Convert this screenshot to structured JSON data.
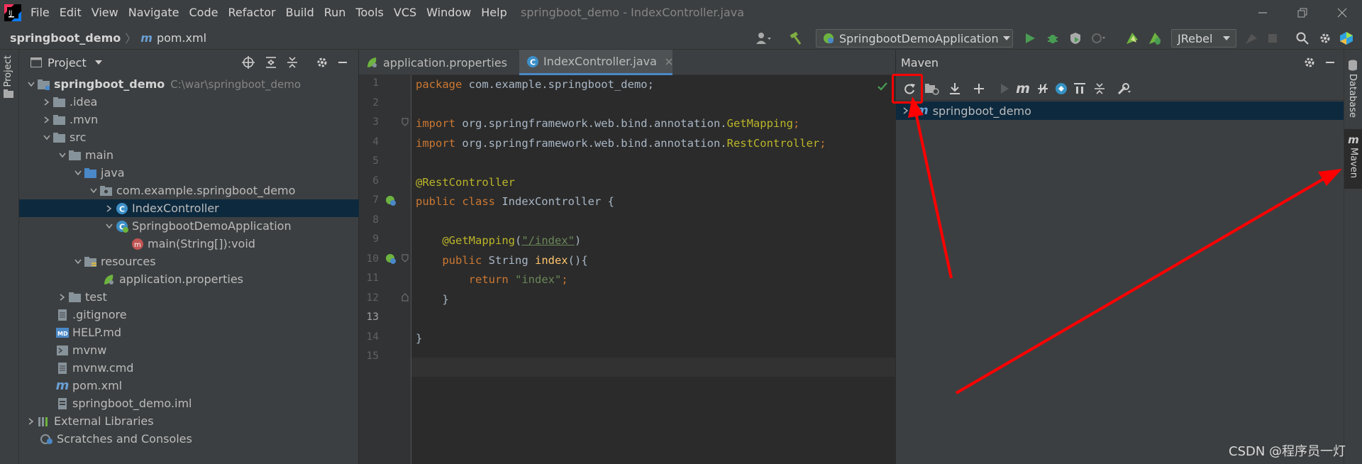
{
  "titlebar": {
    "menu": [
      "File",
      "Edit",
      "View",
      "Navigate",
      "Code",
      "Refactor",
      "Build",
      "Run",
      "Tools",
      "VCS",
      "Window",
      "Help"
    ],
    "title": "springboot_demo - IndexController.java"
  },
  "navbar": {
    "project": "springboot_demo",
    "file": "pom.xml",
    "run_config": "SpringbootDemoApplication",
    "jrebel": "JRebel"
  },
  "left_strip": {
    "project_tab": "Project"
  },
  "right_strip": {
    "database_tab": "Database",
    "maven_tab": "Maven"
  },
  "project_panel": {
    "title": "Project",
    "tree": [
      {
        "label": "springboot_demo",
        "extra": "C:\\war\\springboot_demo",
        "icon": "module-folder-icon"
      },
      {
        "label": ".idea",
        "icon": "folder-icon"
      },
      {
        "label": ".mvn",
        "icon": "folder-icon"
      },
      {
        "label": "src",
        "icon": "folder-icon"
      },
      {
        "label": "main",
        "icon": "folder-icon"
      },
      {
        "label": "java",
        "icon": "source-folder-icon"
      },
      {
        "label": "com.example.springboot_demo",
        "icon": "package-icon"
      },
      {
        "label": "IndexController",
        "icon": "class-icon"
      },
      {
        "label": "SpringbootDemoApplication",
        "icon": "spring-class-icon"
      },
      {
        "label": "main(String[]):void",
        "icon": "method-icon"
      },
      {
        "label": "resources",
        "icon": "resources-folder-icon"
      },
      {
        "label": "application.properties",
        "icon": "properties-file-icon"
      },
      {
        "label": "test",
        "icon": "folder-icon"
      },
      {
        "label": ".gitignore",
        "icon": "text-file-icon"
      },
      {
        "label": "HELP.md",
        "icon": "markdown-file-icon"
      },
      {
        "label": "mvnw",
        "icon": "script-file-icon"
      },
      {
        "label": "mvnw.cmd",
        "icon": "text-file-icon"
      },
      {
        "label": "pom.xml",
        "icon": "maven-icon"
      },
      {
        "label": "springboot_demo.iml",
        "icon": "iml-file-icon"
      },
      {
        "label": "External Libraries",
        "icon": "libraries-icon"
      },
      {
        "label": "Scratches and Consoles",
        "icon": "scratches-icon"
      }
    ]
  },
  "editor": {
    "tabs": [
      "application.properties",
      "IndexController.java"
    ],
    "active_tab": "IndexController.java",
    "line_numbers": [
      "1",
      "2",
      "3",
      "4",
      "5",
      "6",
      "7",
      "8",
      "9",
      "10",
      "11",
      "12",
      "13",
      "14",
      "15"
    ],
    "code": {
      "l1_kw": "package",
      "l1_rest": " com.example.springboot_demo;",
      "l3_kw": "import",
      "l3_pkg": " org.springframework.web.bind.annotation.",
      "l3_cls": "GetMapping",
      "l3_end": ";",
      "l4_kw": "import",
      "l4_pkg": " org.springframework.web.bind.annotation.",
      "l4_cls": "RestController",
      "l4_end": ";",
      "l6_an": "@RestController",
      "l7_kw": "public class",
      "l7_rest": " IndexController {",
      "l9_an": "    @GetMapping",
      "l9_p1": "(",
      "l9_str": "\"/index\"",
      "l9_p2": ")",
      "l10_kw": "    public",
      "l10_mid": " String ",
      "l10_fn": "index",
      "l10_end": "(){",
      "l11_kw": "        return",
      "l11_str": " \"index\"",
      "l11_end": ";",
      "l12": "    }",
      "l14": "}"
    }
  },
  "maven": {
    "title": "Maven",
    "root": "springboot_demo"
  },
  "watermark": "CSDN @程序员一灯",
  "colors": {
    "accent": "#4a88c7",
    "selection": "#0d293e",
    "annotation": "#ff0000"
  }
}
